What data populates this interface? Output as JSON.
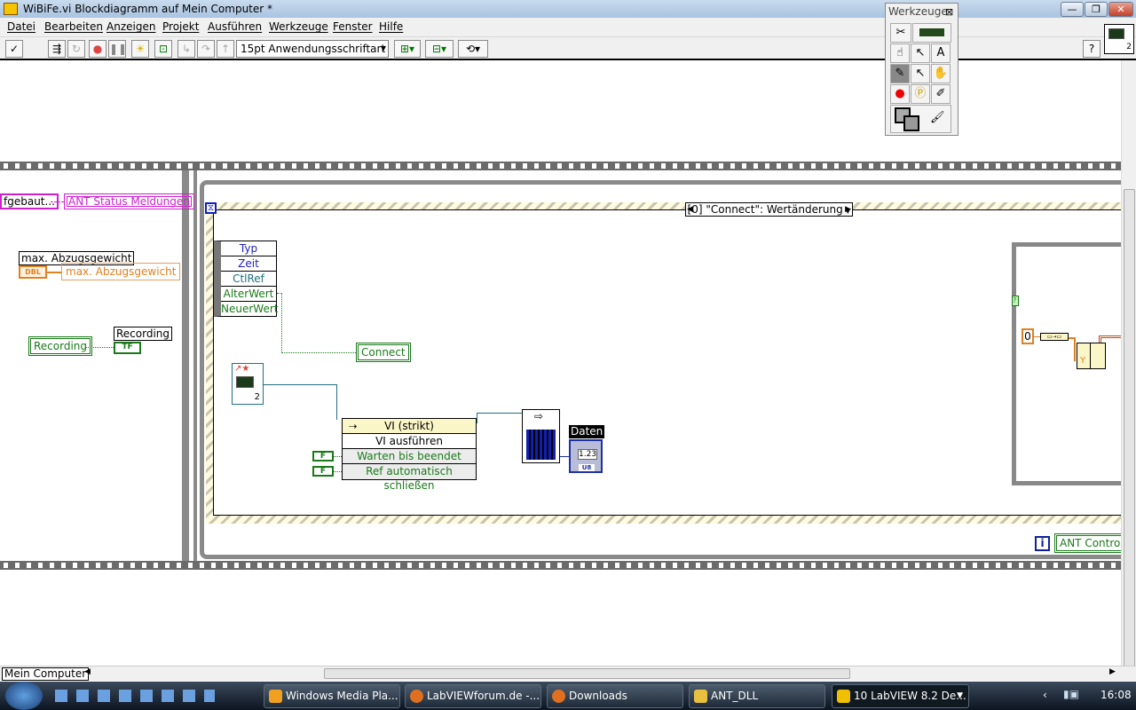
{
  "window": {
    "title": "WiBiFe.vi Blockdiagramm auf Mein Computer *",
    "minimize": "—",
    "restore": "❐",
    "close": "✕"
  },
  "menu": [
    "Datei",
    "Bearbeiten",
    "Anzeigen",
    "Projekt",
    "Ausführen",
    "Werkzeuge",
    "Fenster",
    "Hilfe"
  ],
  "toolbar": {
    "font": "15pt Anwendungsschriftart",
    "help": "?",
    "run": "✓"
  },
  "tools_palette": {
    "title": "Werkzeuge",
    "close": "⊠",
    "active_tool": "wiring"
  },
  "diagram": {
    "left_frame": {
      "string_const": "fgebaut...",
      "status_local": "ANT Status Meldungen",
      "dbl_label": "max. Abzugsgewicht",
      "dbl_type": "DBL",
      "dbl_local": "max. Abzugsgewicht",
      "bool_local": "Recording",
      "bool_label": "Recording",
      "bool_type": "TF"
    },
    "event_selector": "[0] \"Connect\": Wertänderung",
    "event_data": [
      "Typ",
      "Zeit",
      "CtlRef",
      "AlterWert",
      "NeuerWert"
    ],
    "connect_local": "Connect",
    "vi_ref_number": "2",
    "invoke_node": {
      "title": "VI (strikt)",
      "method": "VI ausführen",
      "params": [
        "Warten bis beendet",
        "Ref automatisch schließen"
      ]
    },
    "bool_consts": [
      "F",
      "F"
    ],
    "indicator": {
      "label": "Daten",
      "value": "1.23",
      "type": "U8"
    },
    "numeric_const": "0",
    "loop_iteration": "i",
    "ant_control": "ANT Control",
    "case_selector": "?",
    "type_label": "Y"
  },
  "status": {
    "context": "Mein Computer"
  },
  "taskbar": {
    "items": [
      "Windows Media Pla...",
      "LabVIEWforum.de -...",
      "Downloads",
      "ANT_DLL",
      "10 LabVIEW 8.2 De..."
    ],
    "clock": "16:08"
  }
}
